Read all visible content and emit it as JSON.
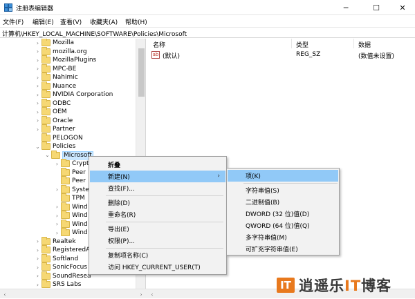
{
  "window": {
    "title": "注册表编辑器"
  },
  "controls": {
    "minimize": "─",
    "maximize": "☐",
    "close": "✕"
  },
  "menu": [
    "文件(F)",
    "编辑(E)",
    "查看(V)",
    "收藏夹(A)",
    "帮助(H)"
  ],
  "address": "计算机\\HKEY_LOCAL_MACHINE\\SOFTWARE\\Policies\\Microsoft",
  "tree": [
    "Mozilla",
    "mozilla.org",
    "MozillaPlugins",
    "MPC-BE",
    "Nahimic",
    "Nuance",
    "NVIDIA Corporation",
    "ODBC",
    "OEM",
    "Oracle",
    "Partner",
    "PELOGON",
    "Policies",
    "Microsoft",
    "Crypt",
    "Peer",
    "Peer",
    "Syste",
    "TPM",
    "Wind",
    "Wind",
    "Wind",
    "Wind",
    "Realtek",
    "RegisteredAp",
    "Softland",
    "SonicFocus",
    "SoundResea",
    "SRS Labs"
  ],
  "columns": {
    "name": "名称",
    "type": "类型",
    "data": "数据"
  },
  "values": [
    {
      "name": "(默认)",
      "type": "REG_SZ",
      "data": "(数值未设置)"
    }
  ],
  "context_menu": {
    "collapse": "折叠",
    "new": "新建(N)",
    "find": "查找(F)...",
    "delete": "删除(D)",
    "rename": "重命名(R)",
    "export": "导出(E)",
    "permissions": "权限(P)...",
    "copy_key_name": "复制项名称(C)",
    "visit": "访问 HKEY_CURRENT_USER(T)"
  },
  "submenu": {
    "key": "项(K)",
    "string": "字符串值(S)",
    "binary": "二进制值(B)",
    "dword": "DWORD (32 位)值(D)",
    "qword": "QWORD (64 位)值(Q)",
    "multi_string": "多字符串值(M)",
    "expandable_string": "可扩充字符串值(E)"
  },
  "watermark": {
    "logo": "IT",
    "text_a": "逍遥乐",
    "text_it": "IT",
    "text_b": "博客"
  },
  "colors": {
    "highlight": "#91c9f7",
    "selection": "#cce8ff",
    "folder": "#f6d874",
    "watermark": "#e8791d"
  }
}
